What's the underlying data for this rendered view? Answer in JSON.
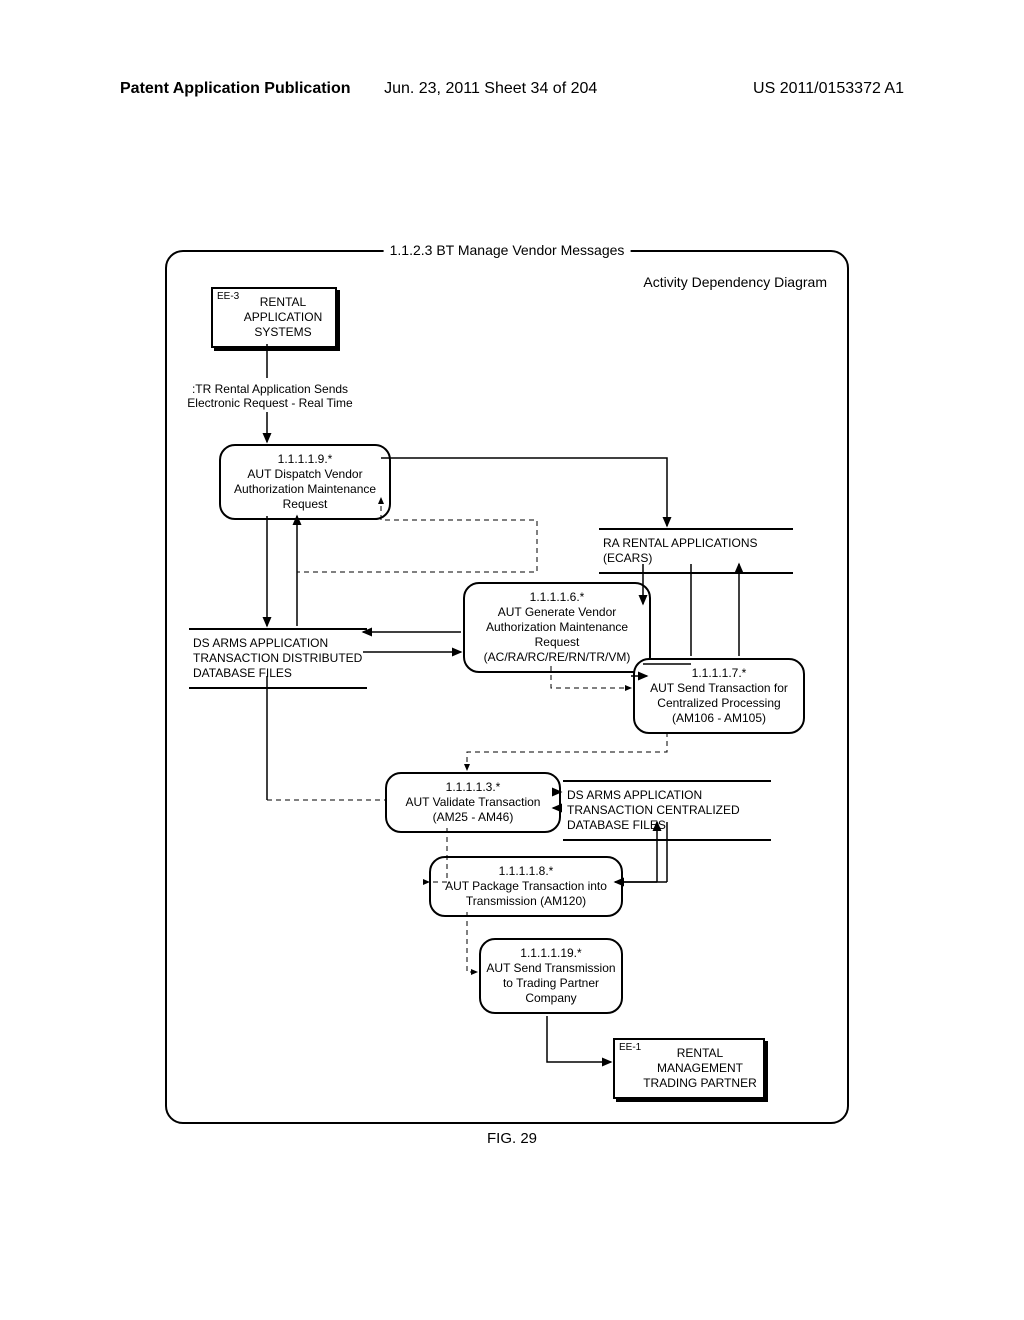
{
  "header": {
    "left": "Patent Application Publication",
    "center": "Jun. 23, 2011  Sheet 34 of 204",
    "right": "US 2011/0153372 A1"
  },
  "diagram": {
    "title": "1.1.2.3 BT Manage Vendor Messages",
    "subtitle": "Activity Dependency Diagram",
    "ee3": {
      "tag": "EE-3",
      "text": "RENTAL APPLICATION SYSTEMS"
    },
    "ee1": {
      "tag": "EE-1",
      "text": "RENTAL MANAGEMENT TRADING PARTNER"
    },
    "tr_label": ":TR Rental Application Sends Electronic Request - Real Time",
    "ra_box": "RA RENTAL APPLICATIONS (ECARS)",
    "ds_dist": "DS ARMS APPLICATION TRANSACTION DISTRIBUTED DATABASE FILES",
    "ds_cent": "DS ARMS APPLICATION TRANSACTION CENTRALIZED DATABASE FILES",
    "p119": {
      "id": "1.1.1.1.9.*",
      "text": "AUT Dispatch Vendor Authorization Maintenance Request"
    },
    "p116": {
      "id": "1.1.1.1.6.*",
      "text": "AUT Generate Vendor Authorization Maintenance Request (AC/RA/RC/RE/RN/TR/VM)"
    },
    "p117": {
      "id": "1.1.1.1.7.*",
      "text": "AUT Send Transaction for Centralized Processing (AM106 - AM105)"
    },
    "p113": {
      "id": "1.1.1.1.3.*",
      "text": "AUT Validate Transaction (AM25 - AM46)"
    },
    "p118": {
      "id": "1.1.1.1.8.*",
      "text": "AUT Package Transaction into Transmission (AM120)"
    },
    "p1119": {
      "id": "1.1.1.1.19.*",
      "text": "AUT Send Transmission to Trading Partner Company"
    }
  },
  "figure_caption": "FIG. 29"
}
